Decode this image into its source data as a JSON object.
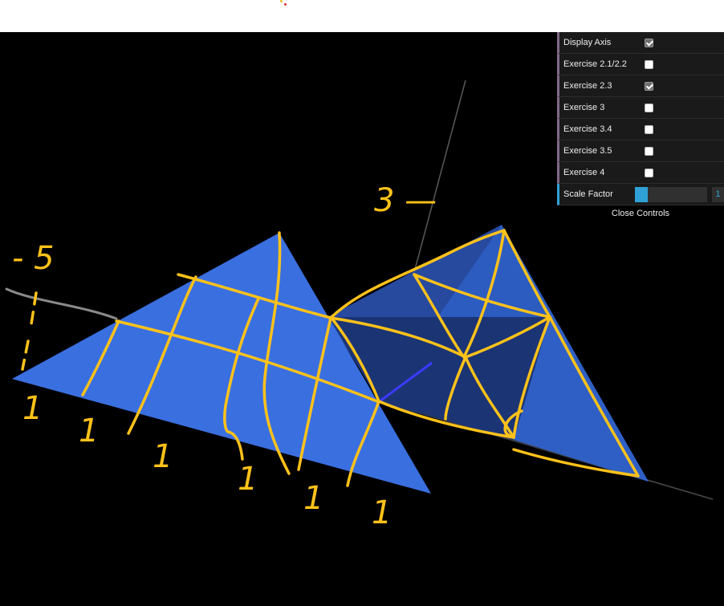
{
  "controls": {
    "items": [
      {
        "label": "Display Axis",
        "checked": true
      },
      {
        "label": "Exercise 2.1/2.2",
        "checked": false
      },
      {
        "label": "Exercise 2.3",
        "checked": true
      },
      {
        "label": "Exercise 3",
        "checked": false
      },
      {
        "label": "Exercise 3.4",
        "checked": false
      },
      {
        "label": "Exercise 3.5",
        "checked": false
      },
      {
        "label": "Exercise 4",
        "checked": false
      }
    ],
    "scale_factor": {
      "label": "Scale Factor",
      "value": "1",
      "fraction": 0.18
    },
    "close_label": "Close Controls"
  },
  "annotations": {
    "label_minus5": "- 5",
    "label_3": "3 —",
    "ones": [
      "1",
      "1",
      "1",
      "1",
      "1",
      "1"
    ]
  },
  "colors": {
    "viewport_bg": "#000000",
    "plane_blue": "#3a6fe0",
    "pyramid_blue": "#2a56b0",
    "pyramid_dark": "#1b3474",
    "annotation_yellow": "#ffc21a",
    "gui_bg": "#1a1a1a",
    "accent_blue": "#2fa1d6",
    "boolean_purple": "#806787"
  }
}
